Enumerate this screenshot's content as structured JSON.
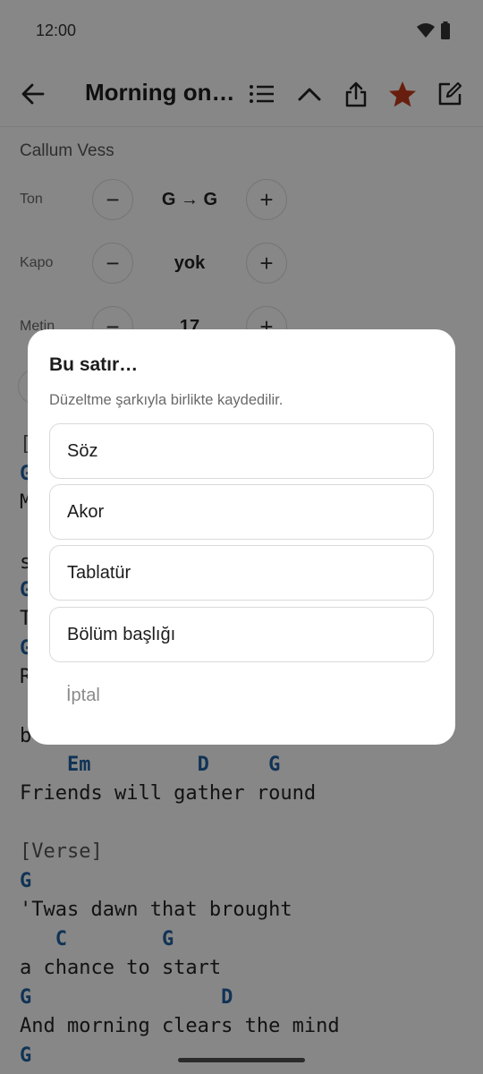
{
  "status_bar": {
    "time": "12:00"
  },
  "toolbar": {
    "title": "Morning on the Hill"
  },
  "song": {
    "artist": "Callum Vess",
    "controls": [
      {
        "label": "Ton",
        "value": "G → G"
      },
      {
        "label": "Kapo",
        "value": "yok"
      },
      {
        "label": "Metin",
        "value": "17"
      }
    ]
  },
  "sheet": {
    "lines": [
      {
        "type": "section",
        "text": "["
      },
      {
        "type": "chord",
        "text": "G"
      },
      {
        "type": "lyric",
        "text": "M"
      },
      {
        "type": "lyric",
        "text": "s"
      },
      {
        "type": "chord",
        "text": "G"
      },
      {
        "type": "lyric",
        "text": "T"
      },
      {
        "type": "chord",
        "text": "G"
      },
      {
        "type": "lyric",
        "text": "R"
      },
      {
        "type": "lyric",
        "text": "b"
      },
      {
        "type": "chord",
        "text": "    Em         D     G"
      },
      {
        "type": "lyric",
        "text": "Friends will gather round"
      },
      {
        "type": "section",
        "text": "[Verse]"
      },
      {
        "type": "chord",
        "text": "G"
      },
      {
        "type": "lyric",
        "text": "'Twas dawn that brought"
      },
      {
        "type": "chord",
        "text": "   C        G"
      },
      {
        "type": "lyric",
        "text": "a chance to start"
      },
      {
        "type": "chord",
        "text": "G                D"
      },
      {
        "type": "lyric",
        "text": "And morning clears the mind"
      },
      {
        "type": "chord",
        "text": "G"
      }
    ]
  },
  "dialog": {
    "title": "Bu satır…",
    "subtitle": "Düzeltme şarkıyla birlikte kaydedilir.",
    "options": [
      "Söz",
      "Akor",
      "Tablatür",
      "Bölüm başlığı"
    ],
    "cancel": "İptal"
  },
  "colors": {
    "accent_star": "#c0391b",
    "chord": "#1f5f9e"
  },
  "icons": [
    "back-arrow-icon",
    "list-icon",
    "chevron-up-icon",
    "share-icon",
    "star-icon",
    "edit-icon",
    "wifi-icon",
    "battery-icon"
  ]
}
